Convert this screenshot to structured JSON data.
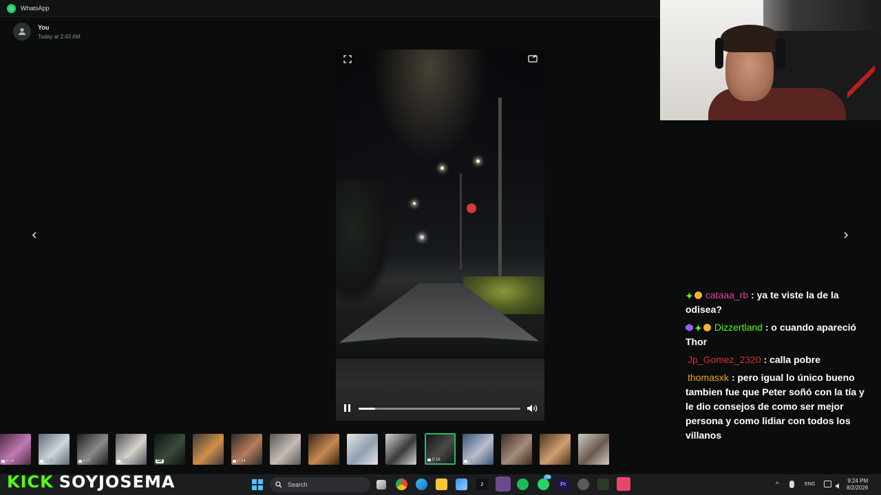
{
  "window": {
    "app_title": "WhatsApp"
  },
  "message": {
    "sender": "You",
    "timestamp": "Today at 2:43 AM"
  },
  "video": {
    "progress": 0.1,
    "playing": true
  },
  "thumbnails": [
    {
      "badge": "0:06",
      "type": "video",
      "c1": "#4a2a44",
      "c2": "#c27ab5"
    },
    {
      "badge": "0:10",
      "type": "video",
      "c1": "#5c6b7a",
      "c2": "#cfd6dc"
    },
    {
      "badge": "0:07",
      "type": "video",
      "c1": "#1c1c1c",
      "c2": "#8a8a8a"
    },
    {
      "badge": "0:04",
      "type": "video",
      "c1": "#4b4f55",
      "c2": "#d7d3cc"
    },
    {
      "badge": "GIF",
      "type": "gif",
      "c1": "#0e1410",
      "c2": "#3a4a3a"
    },
    {
      "badge": "",
      "type": "image",
      "c1": "#3a3a3a",
      "c2": "#d08f4a"
    },
    {
      "badge": "0:04",
      "type": "video",
      "c1": "#2a2a2a",
      "c2": "#b67d5a"
    },
    {
      "badge": "",
      "type": "image",
      "c1": "#5a5755",
      "c2": "#c7bcb4"
    },
    {
      "badge": "",
      "type": "image",
      "c1": "#3a2416",
      "c2": "#c48a52"
    },
    {
      "badge": "",
      "type": "image",
      "c1": "#e6e6e6",
      "c2": "#8fa0b0"
    },
    {
      "badge": "",
      "type": "image",
      "c1": "#d4d4d4",
      "c2": "#3a3a3a"
    },
    {
      "badge": "0:16",
      "type": "video",
      "c1": "#121314",
      "c2": "#4a4c4a",
      "selected": true
    },
    {
      "badge": "0:05",
      "type": "video",
      "c1": "#3a5070",
      "c2": "#b8c0d0"
    },
    {
      "badge": "",
      "type": "image",
      "c1": "#3b2a28",
      "c2": "#a68c7a"
    },
    {
      "badge": "",
      "type": "image",
      "c1": "#4a3222",
      "c2": "#d0a070"
    },
    {
      "badge": "",
      "type": "image",
      "c1": "#d0ccc4",
      "c2": "#6a5a50"
    }
  ],
  "chat": [
    {
      "badges": [
        "plus",
        "coin"
      ],
      "user": "cataaa_rb",
      "color": "#e04595",
      "text": ": ya te viste la de la odisea?"
    },
    {
      "badges": [
        "gem",
        "plus",
        "coin"
      ],
      "user": "Dizzertland",
      "color": "#53fc18",
      "text": ": o cuando apareció Thor"
    },
    {
      "badges": [],
      "user": "Jp_Gomez_2320",
      "color": "#d8283a",
      "text": ": calla pobre"
    },
    {
      "badges": [],
      "user": "thomasxk",
      "color": "#f0a020",
      "text": ": pero igual lo único bueno tambien fue que Peter soñó con la tía y le dio consejos de como ser mejor persona y como lidiar con todos los villanos"
    }
  ],
  "overlay": {
    "platform": "KICK",
    "channel": "SOYJOSEMA"
  },
  "taskbar": {
    "search_placeholder": "Search",
    "language": "ENG",
    "time": "9:24 PM",
    "date": "8/2/2026",
    "whatsapp_badge": "78"
  },
  "colors": {
    "accent": "#21c063",
    "kick_green": "#53fc18"
  }
}
